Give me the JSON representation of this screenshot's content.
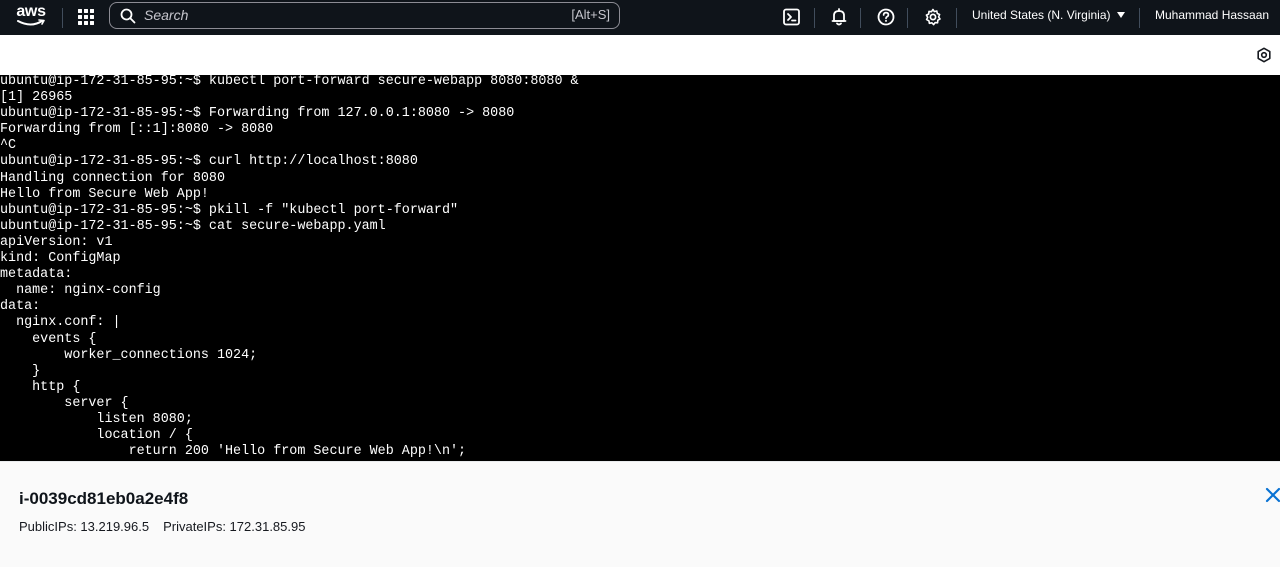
{
  "nav": {
    "logo_text": "aws",
    "search": {
      "placeholder": "Search",
      "shortcut": "[Alt+S]"
    },
    "region_label": "United States (N. Virginia)",
    "user_label": "Muhammad Hassaan"
  },
  "terminal": {
    "lines": [
      "ubuntu@ip-172-31-85-95:~$ kubectl port-forward secure-webapp 8080:8080 &",
      "[1] 26965",
      "ubuntu@ip-172-31-85-95:~$ Forwarding from 127.0.0.1:8080 -> 8080",
      "Forwarding from [::1]:8080 -> 8080",
      "^C",
      "ubuntu@ip-172-31-85-95:~$ curl http://localhost:8080",
      "Handling connection for 8080",
      "Hello from Secure Web App!",
      "ubuntu@ip-172-31-85-95:~$ pkill -f \"kubectl port-forward\"",
      "ubuntu@ip-172-31-85-95:~$ cat secure-webapp.yaml",
      "apiVersion: v1",
      "kind: ConfigMap",
      "metadata:",
      "  name: nginx-config",
      "data:",
      "  nginx.conf: |",
      "    events {",
      "        worker_connections 1024;",
      "    }",
      "    http {",
      "        server {",
      "            listen 8080;",
      "            location / {",
      "                return 200 'Hello from Secure Web App!\\n';"
    ]
  },
  "instance": {
    "id": "i-0039cd81eb0a2e4f8",
    "public_ips": "PublicIPs: 13.219.96.5",
    "private_ips": "PrivateIPs: 172.31.85.95"
  },
  "colors": {
    "nav_bg": "#0f141a",
    "terminal_bg": "#000000",
    "terminal_text": "#ffffff",
    "close_icon": "#0972d3"
  }
}
